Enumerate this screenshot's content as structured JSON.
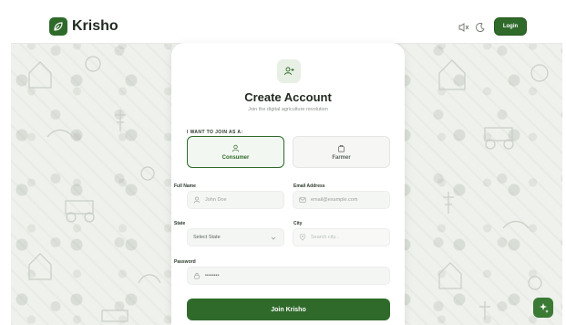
{
  "brand": {
    "name": "Krisho"
  },
  "nav": {
    "login_label": "Login"
  },
  "card": {
    "title": "Create Account",
    "subtitle": "Join the digital agriculture revolution",
    "join_label": "I WANT TO JOIN AS A:",
    "roles": [
      {
        "label": "Consumer",
        "selected": true
      },
      {
        "label": "Farmer",
        "selected": false
      }
    ],
    "fields": {
      "full_name": {
        "label": "Full Name",
        "placeholder": "John Doe"
      },
      "email": {
        "label": "Email Address",
        "placeholder": "email@example.com"
      },
      "state": {
        "label": "State",
        "value": "Select State"
      },
      "city": {
        "label": "City",
        "placeholder": "Search city..."
      },
      "password": {
        "label": "Password",
        "value": "••••••••"
      }
    },
    "submit_label": "Join Krisho"
  },
  "colors": {
    "brand_green": "#2f6a2b",
    "background": "#eef1ec",
    "card": "#ffffff"
  },
  "icons": {
    "logo": "leaf-icon",
    "volume": "volume-mute-icon",
    "theme": "moon-icon",
    "add_user": "user-plus-icon",
    "consumer": "user-icon",
    "farmer": "store-icon",
    "fab": "sparkles-icon"
  }
}
